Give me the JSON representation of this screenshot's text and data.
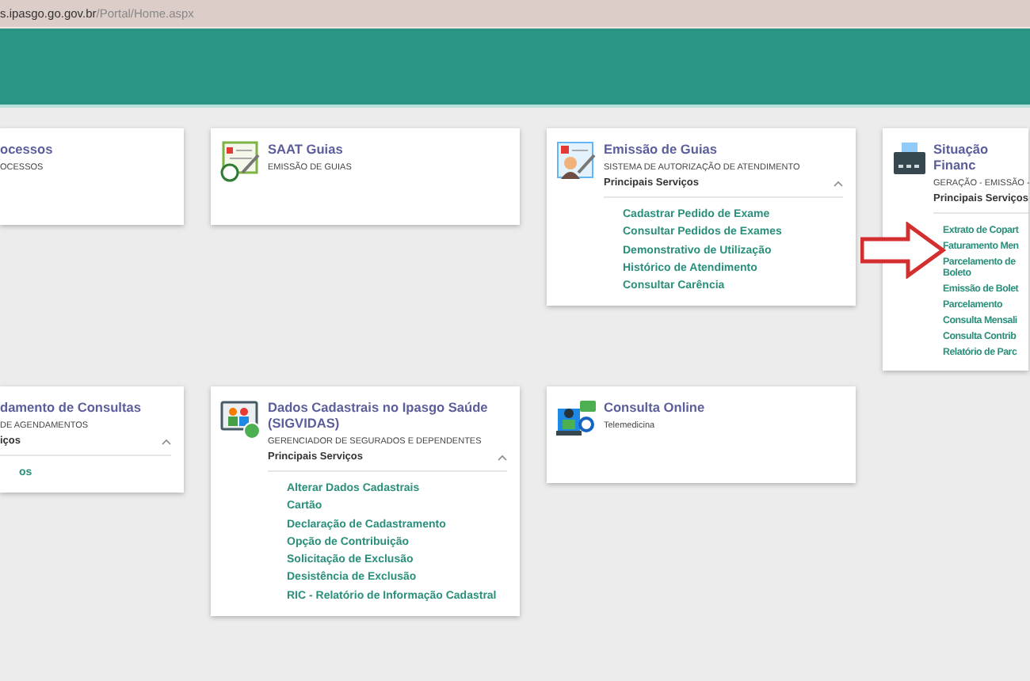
{
  "address_bar": {
    "domain": "s.ipasgo.go.gov.br",
    "path": "/Portal/Home.aspx"
  },
  "cards": [
    {
      "title": "ocessos",
      "subtitle": "OCESSOS"
    },
    {
      "title": "SAAT Guias",
      "subtitle": "EMISSÃO DE GUIAS"
    },
    {
      "title": "Emissão de Guias",
      "subtitle": "SISTEMA DE AUTORIZAÇÃO DE ATENDIMENTO",
      "services": {
        "label": "Principais Serviços",
        "expanded": true,
        "links": [
          "Cadastrar Pedido de Exame",
          "Consultar Pedidos de Exames",
          "Demonstrativo de Utilização",
          "Histórico de Atendimento",
          "Consultar Carência"
        ]
      }
    },
    {
      "title": "Situação Financ",
      "subtitle": "GERAÇÃO - EMISSÃO -",
      "services": {
        "label": "Principais Serviços",
        "expanded": true,
        "links": [
          "Extrato de Copart",
          "Faturamento Men",
          "Parcelamento de Boleto",
          "Emissão de Bolet",
          "Parcelamento",
          "Consulta Mensali",
          "Consulta Contrib",
          "Relatório de Parc"
        ]
      }
    },
    {
      "title": "damento de Consultas",
      "subtitle": "DE AGENDAMENTOS",
      "services": {
        "label": "iços",
        "expanded": true,
        "links": [
          "os"
        ]
      }
    },
    {
      "title": "Dados Cadastrais no Ipasgo Saúde (SIGVIDAS)",
      "subtitle": "GERENCIADOR DE SEGURADOS E DEPENDENTES",
      "services": {
        "label": "Principais Serviços",
        "expanded": true,
        "links": [
          "Alterar Dados Cadastrais",
          "Cartão",
          "Declaração de Cadastramento",
          "Opção de Contribuição",
          "Solicitação de Exclusão",
          "Desistência de Exclusão",
          "RIC - Relatório de Informação Cadastral"
        ]
      }
    },
    {
      "title": "Consulta Online",
      "subtitle": "Telemedicina"
    }
  ]
}
